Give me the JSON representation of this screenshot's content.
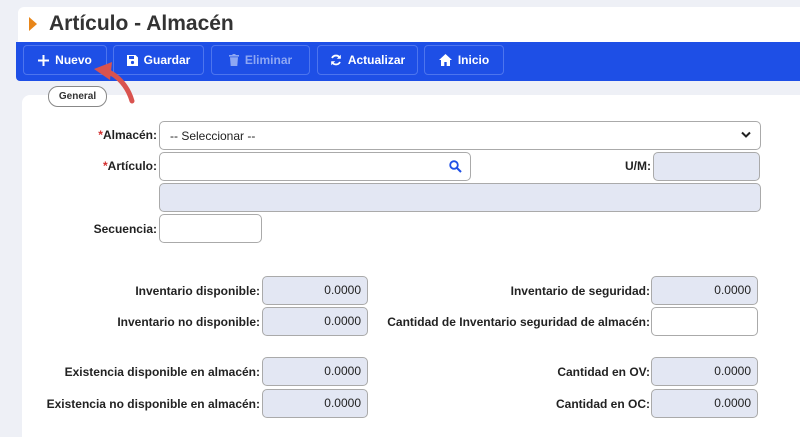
{
  "header": {
    "title": "Artículo - Almacén"
  },
  "toolbar": {
    "new": "Nuevo",
    "save": "Guardar",
    "delete": "Eliminar",
    "refresh": "Actualizar",
    "home": "Inicio"
  },
  "tabs": {
    "general": "General"
  },
  "form": {
    "required_mark": "*",
    "almacen_label": "Almacén:",
    "almacen_value": "-- Seleccionar --",
    "articulo_label": "Artículo:",
    "articulo_value": "",
    "um_label": "U/M:",
    "um_value": "",
    "descripcion_value": "",
    "secuencia_label": "Secuencia:",
    "secuencia_value": "",
    "inv_disponible_label": "Inventario disponible:",
    "inv_disponible_value": "0.0000",
    "inv_no_disponible_label": "Inventario no disponible:",
    "inv_no_disponible_value": "0.0000",
    "inv_seguridad_label": "Inventario de seguridad:",
    "inv_seguridad_value": "0.0000",
    "cant_inv_seg_label": "Cantidad de Inventario seguridad de almacén:",
    "cant_inv_seg_value": "",
    "exist_disp_label": "Existencia disponible en almacén:",
    "exist_disp_value": "0.0000",
    "exist_no_disp_label": "Existencia no disponible en almacén:",
    "exist_no_disp_value": "0.0000",
    "cant_ov_label": "Cantidad en OV:",
    "cant_ov_value": "0.0000",
    "cant_oc_label": "Cantidad en OC:",
    "cant_oc_value": "0.0000"
  },
  "colors": {
    "toolbar": "#1e4fe6",
    "accent": "#e8861a",
    "required": "#d32f2f",
    "readonly": "#e3e7f3",
    "arrow": "#d9534f"
  },
  "icons": [
    "plus-icon",
    "save-icon",
    "trash-icon",
    "refresh-icon",
    "home-icon",
    "search-icon",
    "chevron-down-icon",
    "curved-arrow-icon"
  ]
}
